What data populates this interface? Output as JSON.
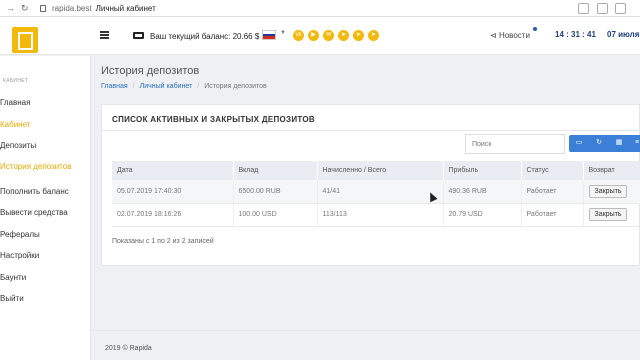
{
  "browser": {
    "host": "rapida.best",
    "tab_title": "Личный кабинет"
  },
  "header": {
    "balance_label": "Ваш текущий баланс: 20.66 $",
    "social_icons": [
      "vk-icon",
      "youtube-icon",
      "mail-icon",
      "telegram-icon",
      "telegram-icon",
      "telegram-icon"
    ],
    "news": "Новости",
    "time": "14 : 31 : 41",
    "date": "07 июля",
    "accent": "#f2b90c"
  },
  "sidebar": {
    "heading": "КАБИНЕТ",
    "items": [
      {
        "label": "Главная",
        "active": false
      },
      {
        "label": "Кабинет",
        "active": true
      },
      {
        "label": "Депозиты",
        "active": false
      },
      {
        "label": "История депозитов",
        "active": true
      },
      {
        "label": "Пополнить баланс",
        "active": false
      },
      {
        "label": "Вывести средства",
        "active": false
      },
      {
        "label": "Рефералы",
        "active": false
      },
      {
        "label": "Настройки",
        "active": false
      },
      {
        "label": "Баунти",
        "active": false
      },
      {
        "label": "Выйти",
        "active": false
      }
    ]
  },
  "page": {
    "title": "История депозитов",
    "breadcrumbs": [
      "Главная",
      "Личный кабинет",
      "История депозитов"
    ]
  },
  "card": {
    "title": "СПИСОК АКТИВНЫХ И ЗАКРЫТЫХ ДЕПОЗИТОВ",
    "search_placeholder": "Поиск",
    "columns": [
      "Дата",
      "Вклад",
      "Начисленно / Всего",
      "Прибыль",
      "Статус",
      "Возврат"
    ],
    "rows": [
      {
        "date": "05.07.2019 17:40:30",
        "deposit": "6500.00 RUB",
        "accrued": "41/41",
        "profit": "490.36 RUB",
        "status": "Работает",
        "action": "Закрыть"
      },
      {
        "date": "02.07.2019 18:16:26",
        "deposit": "100.00 USD",
        "accrued": "113/113",
        "profit": "20.79 USD",
        "status": "Работает",
        "action": "Закрыть"
      }
    ],
    "info": "Показаны с 1 по 2 из 2 записей"
  },
  "footer": {
    "text": "2019 © Rapida"
  }
}
